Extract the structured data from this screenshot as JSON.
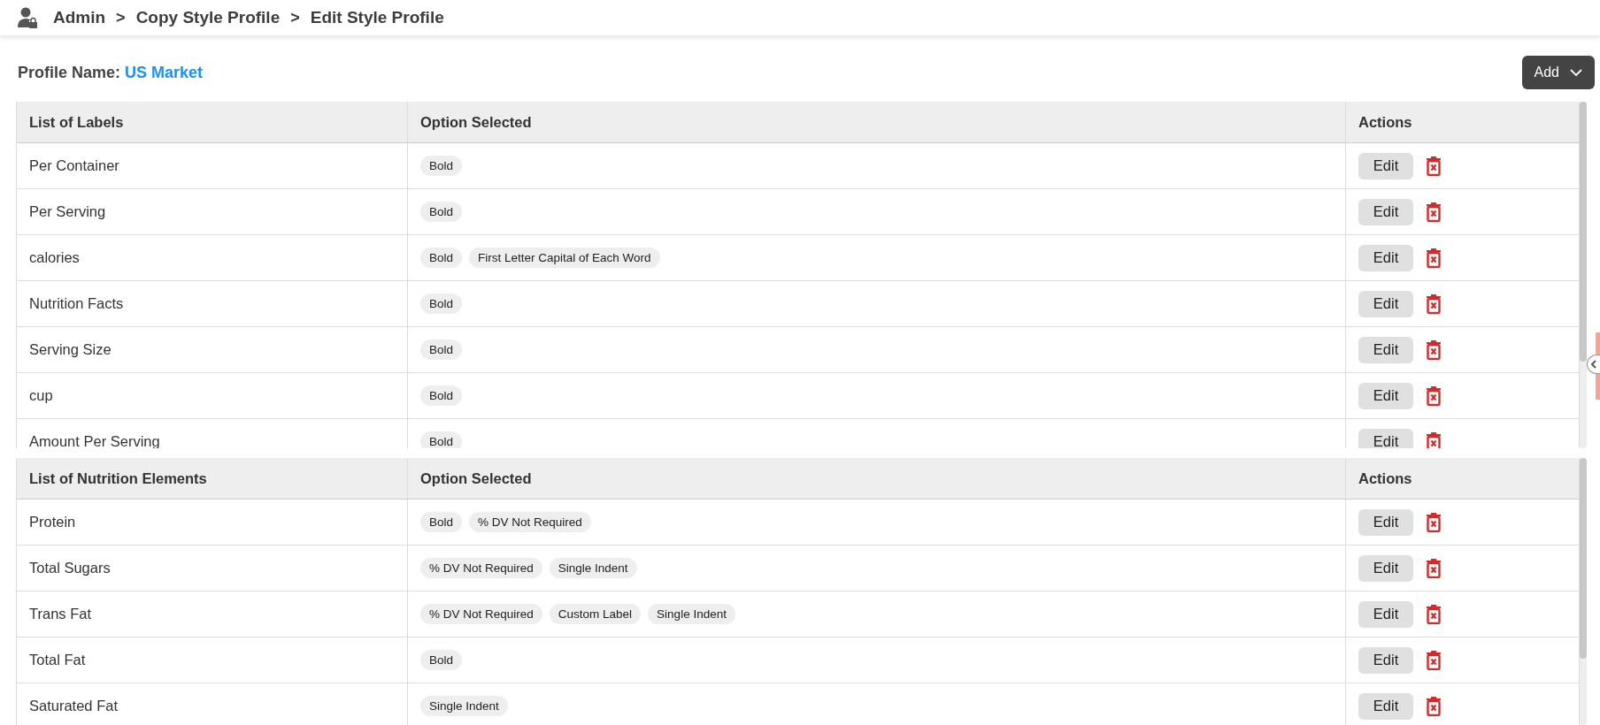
{
  "breadcrumb": {
    "items": [
      "Admin",
      "Copy Style Profile",
      "Edit Style Profile"
    ],
    "separators": [
      ">",
      ">"
    ]
  },
  "profile": {
    "label": "Profile Name:",
    "value": "US Market"
  },
  "add_button": {
    "label": "Add"
  },
  "tables": [
    {
      "columns": [
        "List of Labels",
        "Option Selected",
        "Actions"
      ],
      "rows": [
        {
          "name": "Per Container",
          "options": [
            "Bold"
          ],
          "action": "Edit"
        },
        {
          "name": "Per Serving",
          "options": [
            "Bold"
          ],
          "action": "Edit"
        },
        {
          "name": "calories",
          "options": [
            "Bold",
            "First Letter Capital of Each Word"
          ],
          "action": "Edit"
        },
        {
          "name": "Nutrition Facts",
          "options": [
            "Bold"
          ],
          "action": "Edit"
        },
        {
          "name": "Serving Size",
          "options": [
            "Bold"
          ],
          "action": "Edit"
        },
        {
          "name": "cup",
          "options": [
            "Bold"
          ],
          "action": "Edit"
        },
        {
          "name": "Amount Per Serving",
          "options": [
            "Bold"
          ],
          "action": "Edit"
        }
      ]
    },
    {
      "columns": [
        "List of Nutrition Elements",
        "Option Selected",
        "Actions"
      ],
      "rows": [
        {
          "name": "Protein",
          "options": [
            "Bold",
            "% DV Not Required"
          ],
          "action": "Edit"
        },
        {
          "name": "Total Sugars",
          "options": [
            "% DV Not Required",
            "Single Indent"
          ],
          "action": "Edit"
        },
        {
          "name": "Trans Fat",
          "options": [
            "% DV Not Required",
            "Custom Label",
            "Single Indent"
          ],
          "action": "Edit"
        },
        {
          "name": "Total Fat",
          "options": [
            "Bold"
          ],
          "action": "Edit"
        },
        {
          "name": "Saturated Fat",
          "options": [
            "Single Indent"
          ],
          "action": "Edit"
        }
      ]
    }
  ]
}
